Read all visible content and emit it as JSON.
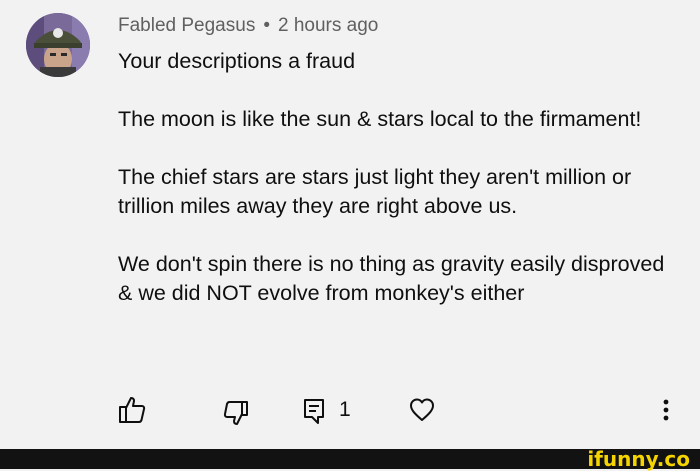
{
  "comment": {
    "author": "Fabled Pegasus",
    "separator": "•",
    "timestamp": "2 hours ago",
    "paragraphs": [
      "Your descriptions a fraud",
      "The moon is like the sun & stars local to the firmament!",
      "The chief stars are stars just light they aren't million or trillion miles away they are right above us.",
      "We don't spin there is no thing as gravity easily disproved & we did NOT evolve from monkey's either"
    ],
    "reply_count": "1"
  },
  "icons": {
    "like": "thumbs-up-icon",
    "dislike": "thumbs-down-icon",
    "reply": "reply-comment-icon",
    "heart": "heart-icon",
    "more": "more-vertical-icon"
  },
  "watermark": "ifunny.co",
  "colors": {
    "background": "#f2f2f2",
    "text": "#0f0f0f",
    "meta": "#606060",
    "footer": "#121212",
    "watermark": "#f5d400"
  }
}
